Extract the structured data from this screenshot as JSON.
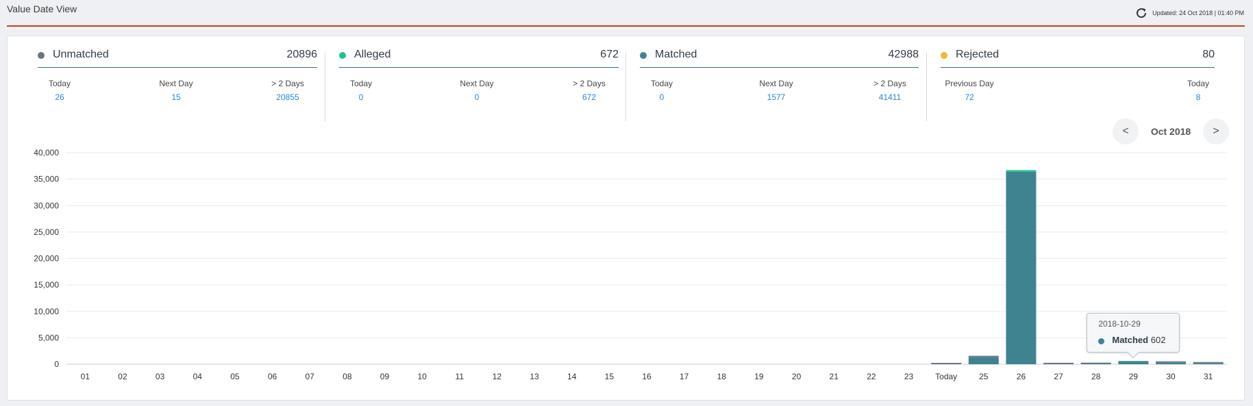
{
  "header": {
    "title": "Value Date View",
    "updated": "Updated: 24 Oct 2018 | 01:40 PM"
  },
  "colors": {
    "accent_rule": "#c9421f",
    "unmatched": "#6b7486",
    "alleged": "#1fc48a",
    "matched": "#3f8390",
    "rejected": "#f5b731",
    "link": "#2a84d8"
  },
  "summary": [
    {
      "label": "Unmatched",
      "total": "20896",
      "color": "#6b7486",
      "subs": [
        {
          "label": "Today",
          "value": "26"
        },
        {
          "label": "Next Day",
          "value": "15"
        },
        {
          "label": "> 2 Days",
          "value": "20855"
        }
      ]
    },
    {
      "label": "Alleged",
      "total": "672",
      "color": "#1fc48a",
      "subs": [
        {
          "label": "Today",
          "value": "0"
        },
        {
          "label": "Next Day",
          "value": "0"
        },
        {
          "label": "> 2 Days",
          "value": "672"
        }
      ]
    },
    {
      "label": "Matched",
      "total": "42988",
      "color": "#3f8390",
      "subs": [
        {
          "label": "Today",
          "value": "0"
        },
        {
          "label": "Next Day",
          "value": "1577"
        },
        {
          "label": "> 2 Days",
          "value": "41411"
        }
      ]
    },
    {
      "label": "Rejected",
      "total": "80",
      "color": "#f5b731",
      "subs": [
        {
          "label": "Previous Day",
          "value": "72"
        },
        {
          "label": "Today",
          "value": "8"
        }
      ]
    }
  ],
  "month_nav": {
    "prev": "<",
    "label": "Oct 2018",
    "next": ">"
  },
  "tooltip": {
    "date": "2018-10-29",
    "series": "Matched",
    "value": "602"
  },
  "chart_data": {
    "type": "bar",
    "stacked": true,
    "categories": [
      "01",
      "02",
      "03",
      "04",
      "05",
      "06",
      "07",
      "08",
      "09",
      "10",
      "11",
      "12",
      "13",
      "14",
      "15",
      "16",
      "17",
      "18",
      "19",
      "20",
      "21",
      "22",
      "23",
      "Today",
      "25",
      "26",
      "27",
      "28",
      "29",
      "30",
      "31"
    ],
    "series": [
      {
        "name": "Matched",
        "color": "#3f8390",
        "values": [
          0,
          0,
          0,
          0,
          0,
          0,
          0,
          0,
          0,
          0,
          0,
          0,
          0,
          0,
          0,
          0,
          0,
          0,
          0,
          0,
          0,
          0,
          0,
          60,
          1400,
          36400,
          80,
          100,
          602,
          350,
          220
        ]
      },
      {
        "name": "Alleged",
        "color": "#1fc48a",
        "values": [
          0,
          0,
          0,
          0,
          0,
          0,
          0,
          0,
          0,
          0,
          0,
          0,
          0,
          0,
          0,
          0,
          0,
          0,
          0,
          0,
          0,
          0,
          0,
          0,
          0,
          300,
          0,
          0,
          0,
          0,
          0
        ]
      },
      {
        "name": "Unmatched",
        "color": "#6b7486",
        "values": [
          0,
          0,
          0,
          0,
          0,
          0,
          0,
          0,
          0,
          0,
          0,
          0,
          0,
          0,
          0,
          0,
          0,
          0,
          0,
          0,
          0,
          0,
          0,
          20,
          150,
          0,
          40,
          40,
          0,
          40,
          40
        ]
      }
    ],
    "ylim": [
      0,
      40000
    ],
    "yticks": [
      "0",
      "5,000",
      "10,000",
      "15,000",
      "20,000",
      "25,000",
      "30,000",
      "35,000",
      "40,000"
    ],
    "grid": true,
    "legend": "none"
  }
}
